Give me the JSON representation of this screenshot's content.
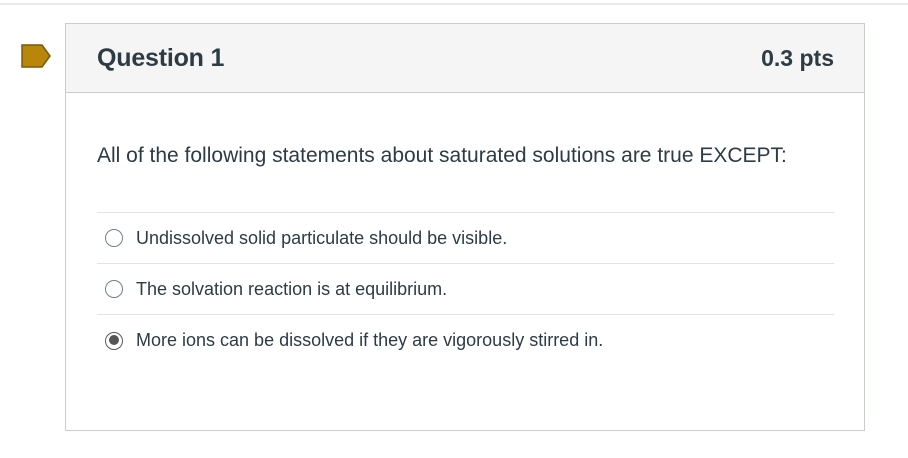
{
  "question": {
    "title": "Question 1",
    "points": "0.3 pts",
    "text": "All of the following statements about saturated solutions are true EXCEPT:",
    "flag_icon": "flag-icon",
    "flag_color": "#b8860b",
    "answers": [
      {
        "label": "Undissolved solid particulate should be visible.",
        "selected": false
      },
      {
        "label": "The solvation reaction is at equilibrium.",
        "selected": false
      },
      {
        "label": "More ions can be dissolved if they are vigorously stirred in.",
        "selected": true
      }
    ]
  }
}
